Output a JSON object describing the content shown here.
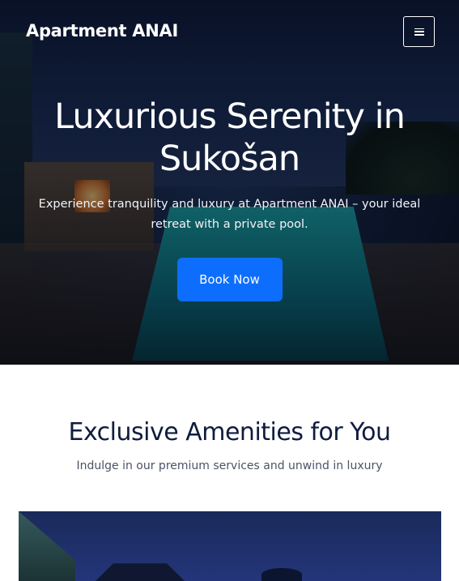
{
  "header": {
    "brand": "Apartment ANAI"
  },
  "hero": {
    "title": "Luxurious Serenity in Sukošan",
    "subtitle": "Experience tranquility and luxury at Apartment ANAI – your ideal retreat with a private pool.",
    "cta_label": "Book Now"
  },
  "amenities": {
    "title": "Exclusive Amenities for You",
    "subtitle": "Indulge in our premium services and unwind in luxury"
  },
  "colors": {
    "accent": "#0d6efd",
    "heading": "#0f1c3f"
  },
  "icons": {
    "menu": "hamburger-menu-icon"
  }
}
